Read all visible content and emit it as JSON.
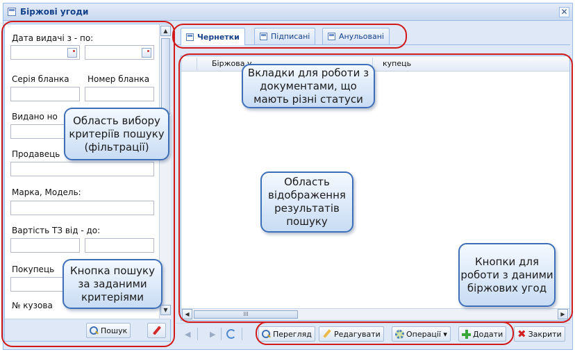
{
  "window": {
    "title": "Біржові угоди",
    "close_glyph": "✕"
  },
  "filters": {
    "date_label": "Дата видачі з - по:",
    "serie_label": "Серія бланка",
    "number_label": "Номер бланка",
    "issued_label": "Видано но",
    "seller_label": "Продавець",
    "model_label": "Марка, Модель:",
    "cost_label": "Вартість ТЗ від - до:",
    "buyer_label": "Покупець",
    "vin_label": "№ кузова",
    "search_button": "Пошук"
  },
  "tabs": [
    {
      "label": "Чернетки",
      "active": true
    },
    {
      "label": "Підписані",
      "active": false
    },
    {
      "label": "Анульовані",
      "active": false
    }
  ],
  "grid": {
    "columns": [
      "Біржова у",
      "купець"
    ],
    "hscroll_grip": "III"
  },
  "toolbar": {
    "view": "Перегляд",
    "edit": "Редагувати",
    "operations": "Операції ▾",
    "add": "Додати",
    "close": "Закрити"
  },
  "annotations": {
    "tabs_note": "Вкладки для роботи з документами, що мають різні статуси",
    "filter_note": "Область вибору критеріїв пошуку (фільтрації)",
    "results_note": "Область відображення результатів пошуку",
    "search_note": "Кнопка пошуку за заданими критеріями",
    "buttons_note": "Кнопки для роботи з даними біржових угод"
  },
  "colors": {
    "ring": "#d11919",
    "callout_border": "#3d6fb8",
    "header": "#15428b"
  }
}
